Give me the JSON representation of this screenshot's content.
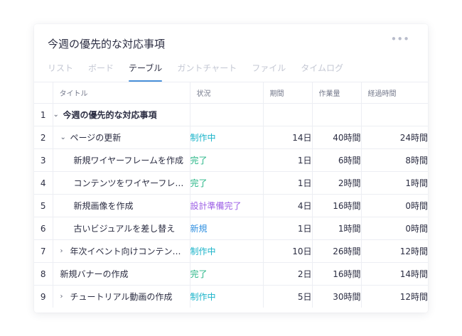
{
  "header": {
    "title": "今週の優先的な対応事項",
    "more_glyph": "•••"
  },
  "tabs": [
    {
      "label": "リスト",
      "active": false
    },
    {
      "label": "ボード",
      "active": false
    },
    {
      "label": "テーブル",
      "active": true
    },
    {
      "label": "ガントチャート",
      "active": false
    },
    {
      "label": "ファイル",
      "active": false
    },
    {
      "label": "タイムログ",
      "active": false
    }
  ],
  "columns": {
    "title": "タイトル",
    "status": "状況",
    "duration": "期間",
    "work": "作業量",
    "elapsed": "経過時間"
  },
  "colors": {
    "in_progress": "#19b3c9",
    "done": "#25b585",
    "design_done": "#9b5de5",
    "new": "#2f8fe0",
    "accent": "#4a90d9"
  },
  "rows": [
    {
      "num": "1",
      "caret": "⌄",
      "indent": 0,
      "title": "今週の優先的な対応事項",
      "bold": true,
      "status": "",
      "status_color": "",
      "duration": "",
      "work": "",
      "elapsed": ""
    },
    {
      "num": "2",
      "caret": "⌄",
      "indent": 1,
      "title": "ページの更新",
      "bold": false,
      "status": "制作中",
      "status_color": "#19b3c9",
      "duration": "14日",
      "work": "40時間",
      "elapsed": "24時間"
    },
    {
      "num": "3",
      "caret": "",
      "indent": 2,
      "title": "新規ワイヤーフレームを作成",
      "bold": false,
      "status": "完了",
      "status_color": "#25b585",
      "duration": "1日",
      "work": "6時間",
      "elapsed": "8時間"
    },
    {
      "num": "4",
      "caret": "",
      "indent": 2,
      "title": "コンテンツをワイヤーフレームに追加",
      "bold": false,
      "status": "完了",
      "status_color": "#25b585",
      "duration": "1日",
      "work": "2時間",
      "elapsed": "1時間"
    },
    {
      "num": "5",
      "caret": "",
      "indent": 2,
      "title": "新規画像を作成",
      "bold": false,
      "status": "設計準備完了",
      "status_color": "#9b5de5",
      "duration": "4日",
      "work": "16時間",
      "elapsed": "0時間"
    },
    {
      "num": "6",
      "caret": "",
      "indent": 2,
      "title": "古いビジュアルを差し替え",
      "bold": false,
      "status": "新規",
      "status_color": "#2f8fe0",
      "duration": "1日",
      "work": "1時間",
      "elapsed": "0時間"
    },
    {
      "num": "7",
      "caret": "›",
      "indent": 1,
      "title": "年次イベント向けコンテンツ作成",
      "bold": false,
      "status": "制作中",
      "status_color": "#19b3c9",
      "duration": "10日",
      "work": "26時間",
      "elapsed": "12時間"
    },
    {
      "num": "8",
      "caret": "",
      "indent": 1,
      "title": "新規バナーの作成",
      "bold": false,
      "status": "完了",
      "status_color": "#25b585",
      "duration": "2日",
      "work": "16時間",
      "elapsed": "14時間"
    },
    {
      "num": "9",
      "caret": "›",
      "indent": 1,
      "title": "チュートリアル動画の作成",
      "bold": false,
      "status": "制作中",
      "status_color": "#19b3c9",
      "duration": "5日",
      "work": "30時間",
      "elapsed": "12時間"
    }
  ]
}
